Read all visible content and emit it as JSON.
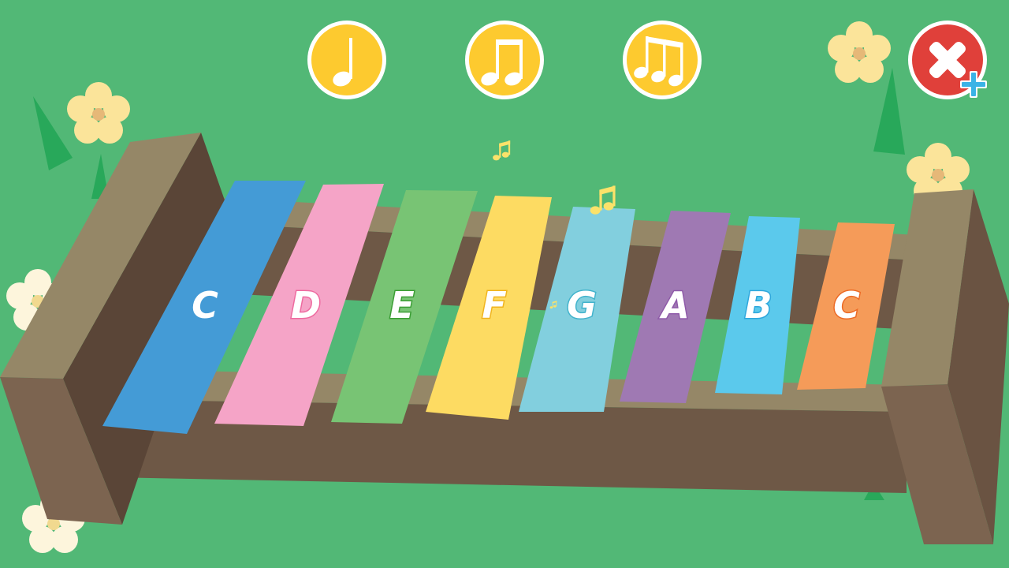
{
  "toolbar": {
    "buttons": [
      {
        "name": "single-note-button",
        "icon": "quarter-note-icon"
      },
      {
        "name": "double-note-button",
        "icon": "eighth-notes-icon"
      },
      {
        "name": "triple-note-button",
        "icon": "triplet-notes-icon"
      }
    ],
    "accent_color": "#fdca2f",
    "close_button": {
      "icon": "close-x-icon",
      "color": "#e0403a"
    }
  },
  "xylophone": {
    "keys": [
      {
        "note": "C",
        "color": "#449bd6",
        "label_color": "#449bd6"
      },
      {
        "note": "D",
        "color": "#f5a4c7",
        "label_color": "#ee6a9f"
      },
      {
        "note": "E",
        "color": "#78c474",
        "label_color": "#3c9e35"
      },
      {
        "note": "F",
        "color": "#fddb62",
        "label_color": "#f0b41e"
      },
      {
        "note": "G",
        "color": "#82cfde",
        "label_color": "#42b3cc"
      },
      {
        "note": "A",
        "color": "#9f79b3",
        "label_color": "#8f5aa9"
      },
      {
        "note": "B",
        "color": "#5bc9ec",
        "label_color": "#2ea7dc"
      },
      {
        "note": "C",
        "color": "#f59b59",
        "label_color": "#ec6a25"
      }
    ]
  },
  "background": {
    "color": "#52b876",
    "flower_color": "#fbe49a"
  }
}
